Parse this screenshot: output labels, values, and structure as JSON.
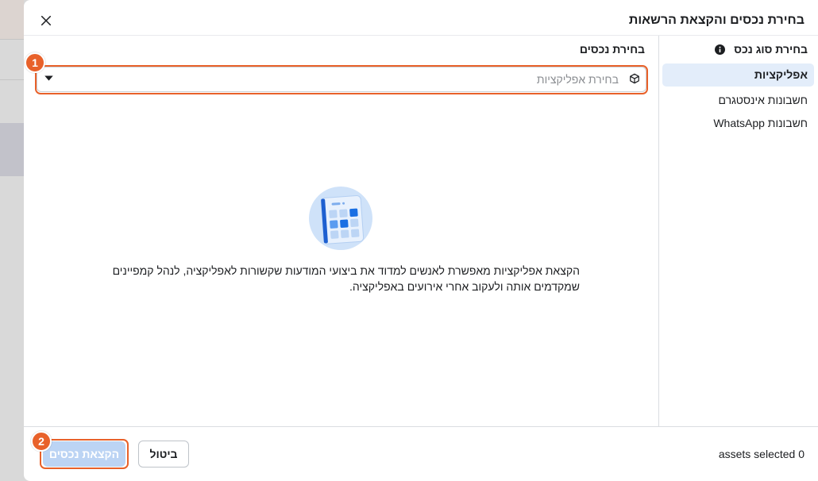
{
  "dialog": {
    "title": "בחירת נכסים והקצאת הרשאות",
    "close_icon": "close-icon"
  },
  "sidebar": {
    "heading": "בחירת סוג נכס",
    "heading_icon": "info-icon",
    "items": [
      {
        "label": "אפליקציות",
        "selected": true
      },
      {
        "label": "חשבונות אינסטגרם",
        "selected": false
      },
      {
        "label": "חשבונות WhatsApp",
        "selected": false
      }
    ]
  },
  "main": {
    "heading": "בחירת נכסים",
    "select": {
      "placeholder": "בחירת אפליקציות",
      "leading_icon": "cube-icon",
      "trailing_icon": "caret-down-icon"
    },
    "illustration": "app-grid-illustration",
    "description_lines": [
      "הקצאת אפליקציות מאפשרת לאנשים למדוד את ביצועי המודעות שקשורות לאפליקציה, לנהל קמפיינים",
      "שמקדמים אותה ולעקוב אחרי אירועים באפליקציה."
    ]
  },
  "footer": {
    "selection_status": "assets selected 0",
    "cancel_label": "ביטול",
    "assign_label": "הקצאת נכסים",
    "assign_disabled": true
  },
  "annotations": [
    {
      "number": "1"
    },
    {
      "number": "2"
    }
  ],
  "colors": {
    "text": "#1c1e21",
    "muted": "#8a8d91",
    "divider": "#dadde1",
    "selected_bg": "#e3edfa",
    "annotation": "#e8612a",
    "primary_disabled": "#bcd4f4"
  }
}
